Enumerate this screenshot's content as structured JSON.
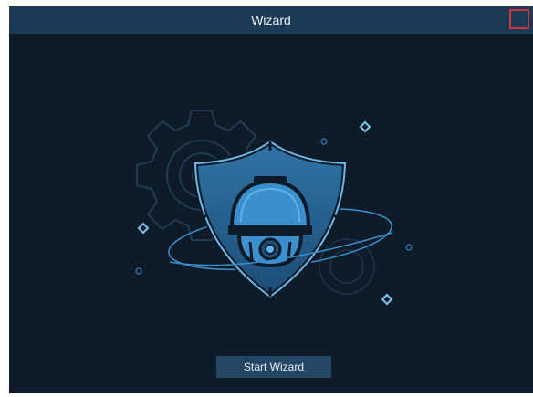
{
  "window": {
    "title": "Wizard"
  },
  "close_button": {
    "icon": "close-box-icon"
  },
  "illustration": {
    "icons": [
      "gear-icon",
      "shield-icon",
      "dome-camera-icon",
      "orbit-ring",
      "sparkle-icon"
    ]
  },
  "actions": {
    "start_label": "Start Wizard"
  },
  "colors": {
    "background": "#0e1c29",
    "titlebar": "#1b3a55",
    "accent": "#3aa0e0",
    "button": "#254766",
    "close_outline": "#d1343d"
  }
}
